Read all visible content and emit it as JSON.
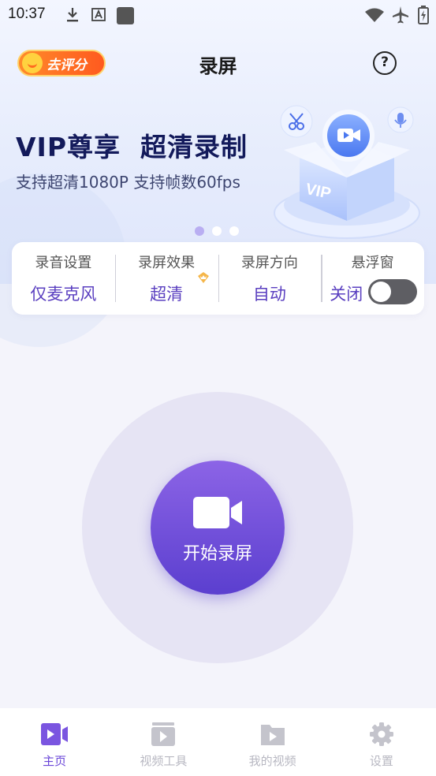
{
  "status_bar": {
    "time": "10:37",
    "icons": [
      "download-icon",
      "keyboard-a-icon",
      "square-notification-icon",
      "wifi-icon",
      "airplane-mode-icon",
      "battery-charging-icon"
    ]
  },
  "header": {
    "rate_label": "去评分",
    "title": "录屏",
    "help_label": "?"
  },
  "banner": {
    "title": "VIP尊享  超清录制",
    "subtitle": "支持超清1080P 支持帧数60fps",
    "illustration_text": "VIP",
    "page_count": 3,
    "active_page": 1
  },
  "settings": {
    "audio": {
      "label": "录音设置",
      "value": "仅麦克风"
    },
    "quality": {
      "label": "录屏效果",
      "value": "超清"
    },
    "orientation": {
      "label": "录屏方向",
      "value": "自动"
    },
    "floating": {
      "label": "悬浮窗",
      "value": "关闭",
      "enabled": false
    }
  },
  "record": {
    "label": "开始录屏"
  },
  "bottom_nav": {
    "items": [
      {
        "label": "主页",
        "icon": "video-camera-icon",
        "active": true
      },
      {
        "label": "视频工具",
        "icon": "video-tools-icon",
        "active": false
      },
      {
        "label": "我的视频",
        "icon": "video-folder-icon",
        "active": false
      },
      {
        "label": "设置",
        "icon": "gear-icon",
        "active": false
      }
    ]
  },
  "colors": {
    "accent": "#5b3fcf",
    "accent_light": "#8c64e6",
    "rate_orange": "#ff6a1f",
    "title_navy": "#131a5b",
    "inactive_nav": "#b8b8c2"
  }
}
